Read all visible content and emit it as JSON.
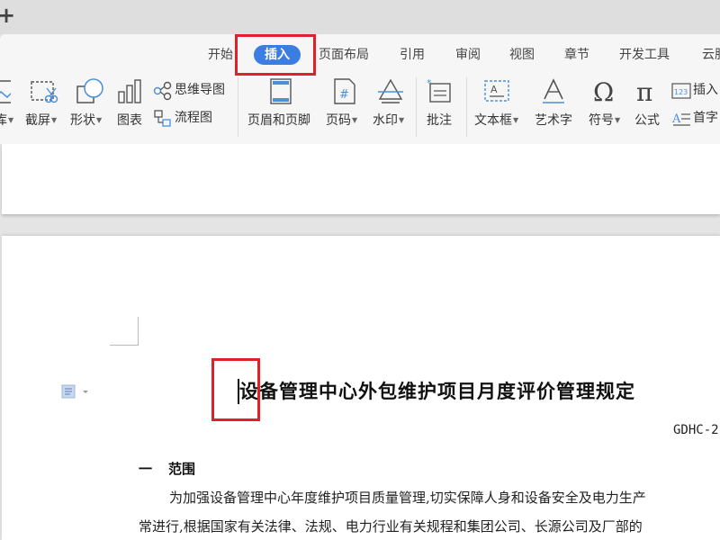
{
  "titlebar": {
    "new_tab_glyph": "+"
  },
  "ribbon": {
    "tabs": [
      {
        "label": "开始"
      },
      {
        "label": "插入",
        "active": true
      },
      {
        "label": "页面布局"
      },
      {
        "label": "引用"
      },
      {
        "label": "审阅"
      },
      {
        "label": "视图"
      },
      {
        "label": "章节"
      },
      {
        "label": "开发工具"
      },
      {
        "label": "云服"
      }
    ],
    "tools": {
      "picture": "库",
      "screenshot": "截屏",
      "shape": "形状",
      "chart": "图表",
      "mindmap": "思维导图",
      "flowchart": "流程图",
      "header_footer": "页眉和页脚",
      "page_number": "页码",
      "watermark": "水印",
      "comment": "批注",
      "textbox": "文本框",
      "wordart": "艺术字",
      "symbol": "符号",
      "formula": "公式",
      "insert_number": "插入",
      "dropcap": "首字"
    },
    "accent_color": "#3b7de0",
    "highlight_color": "#e0212a"
  },
  "document": {
    "title": "设备管理中心外包维护项目月度评价管理规定",
    "doc_number": "GDHC-2",
    "section": {
      "number": "一",
      "title": "范围"
    },
    "paragraph_lines": [
      "为加强设备管理中心年度维护项目质量管理,切实保障人身和设备安全及电力生产",
      "常进行,根据国家有关法律、法规、电力行业有关规程和集团公司、长源公司及厂部的"
    ]
  }
}
